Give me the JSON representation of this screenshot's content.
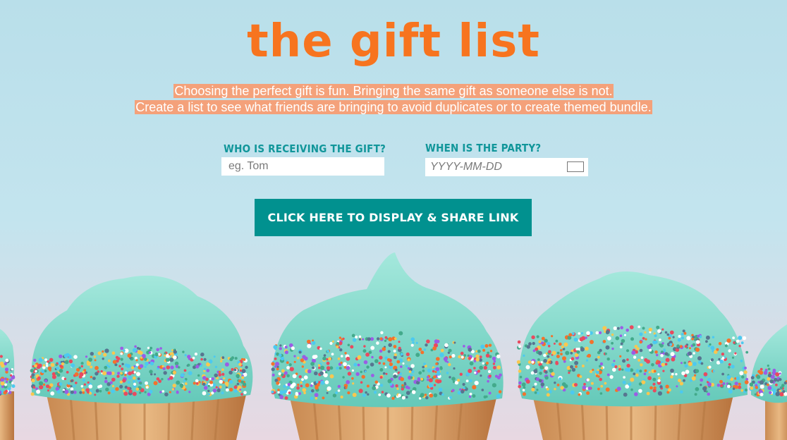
{
  "header": {
    "title": "the gift list",
    "tagline_line1": "Choosing the perfect gift is fun. Bringing the same gift as someone else is not.",
    "tagline_line2": "Create a list to see what friends are bringing to avoid duplicates or to create themed bundle."
  },
  "form": {
    "recipient_label": "WHO IS RECEIVING THE GIFT?",
    "recipient_placeholder": "eg. Tom",
    "recipient_value": "",
    "date_label": "WHEN IS THE PARTY?",
    "date_placeholder": "YYYY-MM-DD",
    "date_value": "",
    "share_button_label": "CLICK HERE TO DISPLAY & SHARE LINK"
  },
  "icons": {
    "calendar": "calendar-icon"
  },
  "colors": {
    "title": "#f7741f",
    "tagline_highlight": "#f4a17a",
    "label": "#11969a",
    "button": "#01918f",
    "background_sky": "#bfe2ec",
    "frosting": "#7fd8c8"
  }
}
